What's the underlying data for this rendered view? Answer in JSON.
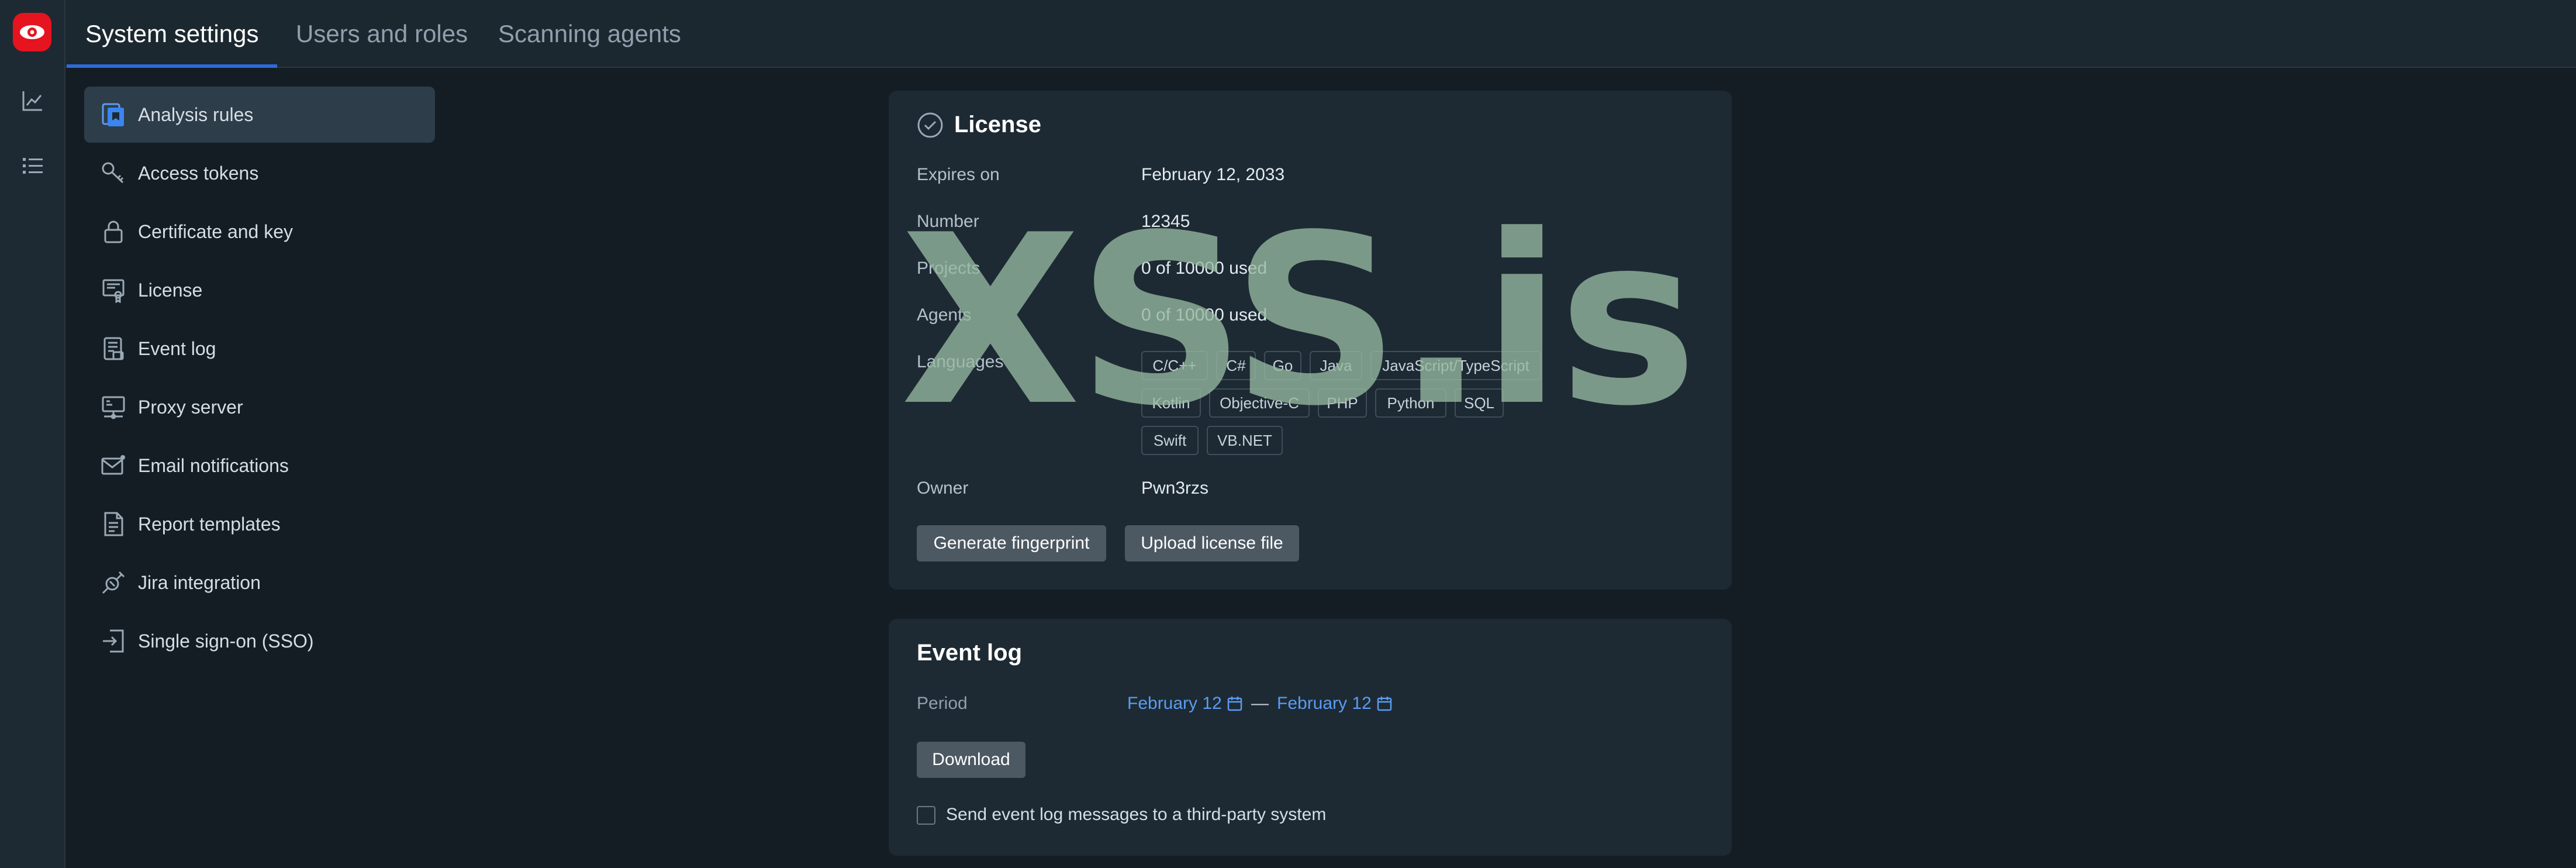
{
  "app": {
    "brand_color": "#e5141f",
    "accent_color": "#2d6ad8",
    "link_color": "#5b9cf2"
  },
  "rail": {
    "items": [
      {
        "icon": "chart-icon"
      },
      {
        "icon": "list-icon"
      }
    ]
  },
  "tabs": [
    {
      "label": "System settings",
      "active": true
    },
    {
      "label": "Users and roles",
      "active": false
    },
    {
      "label": "Scanning agents",
      "active": false
    }
  ],
  "sidebar": {
    "items": [
      {
        "label": "Analysis rules",
        "icon": "rules-icon",
        "active": true
      },
      {
        "label": "Access tokens",
        "icon": "key-icon"
      },
      {
        "label": "Certificate and key",
        "icon": "lock-icon"
      },
      {
        "label": "License",
        "icon": "license-icon"
      },
      {
        "label": "Event log",
        "icon": "event-log-icon"
      },
      {
        "label": "Proxy server",
        "icon": "proxy-icon"
      },
      {
        "label": "Email notifications",
        "icon": "mail-icon"
      },
      {
        "label": "Report templates",
        "icon": "document-icon"
      },
      {
        "label": "Jira integration",
        "icon": "plug-icon"
      },
      {
        "label": "Single sign-on (SSO)",
        "icon": "sign-in-icon"
      }
    ]
  },
  "license": {
    "title": "License",
    "rows": {
      "expires_label": "Expires on",
      "expires_value": "February 12, 2033",
      "number_label": "Number",
      "number_value": "12345",
      "projects_label": "Projects",
      "projects_value": "0 of 10000 used",
      "agents_label": "Agents",
      "agents_value": "0 of 10000 used",
      "languages_label": "Languages",
      "owner_label": "Owner",
      "owner_value": "Pwn3rzs"
    },
    "languages": [
      "C/C++",
      "C#",
      "Go",
      "Java",
      "JavaScript/TypeScript",
      "Kotlin",
      "Objective-C",
      "PHP",
      "Python",
      "SQL",
      "Swift",
      "VB.NET"
    ],
    "buttons": {
      "fingerprint": "Generate fingerprint",
      "upload": "Upload license file"
    }
  },
  "event_log": {
    "title": "Event log",
    "period_label": "Period",
    "date_from": "February 12",
    "date_separator": "—",
    "date_to": "February 12",
    "download_label": "Download",
    "checkbox_label": "Send event log messages to a third-party system",
    "checkbox_checked": false
  },
  "watermark": {
    "text": "XSS.is"
  }
}
